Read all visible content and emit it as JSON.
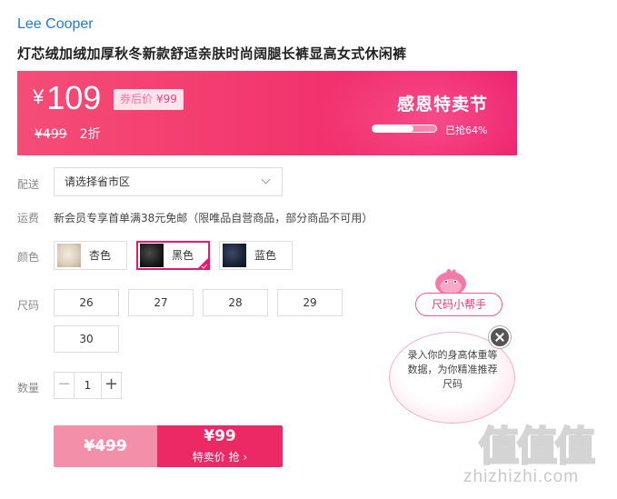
{
  "brand": "Lee Cooper",
  "product_title": "灯芯绒加绒加厚秋冬新款舒适亲肤时尚阔腿长裤显高女式休闲裤",
  "price_banner": {
    "currency": "¥",
    "price": "109",
    "coupon_label": "券后价",
    "coupon_price": "¥99",
    "original_price": "¥499",
    "discount": "2折",
    "festival": "感恩特卖节",
    "progress_percent": 64,
    "progress_text": "已抢64%"
  },
  "delivery": {
    "label": "配送",
    "placeholder": "请选择省市区"
  },
  "shipping": {
    "label": "运费",
    "text": "新会员专享首单满38元免邮（限唯品自营商品，部分商品不可用）"
  },
  "color": {
    "label": "颜色",
    "options": [
      {
        "name": "杏色",
        "selected": false
      },
      {
        "name": "黑色",
        "selected": true
      },
      {
        "name": "蓝色",
        "selected": false
      }
    ]
  },
  "size": {
    "label": "尺码",
    "options": [
      "26",
      "27",
      "28",
      "29",
      "30"
    ]
  },
  "quantity": {
    "label": "数量",
    "minus": "−",
    "value": "1",
    "plus": "+"
  },
  "buy": {
    "original_price": "¥499",
    "price": "¥99",
    "action_label": "特卖价 抢 ›"
  },
  "size_helper": {
    "tag": "尺码小帮手",
    "bubble_text": "录入你的身高体重等数据，为你精准推荐尺码"
  },
  "watermark": {
    "logo": "值值值",
    "url": "zhizhizhi.com"
  }
}
